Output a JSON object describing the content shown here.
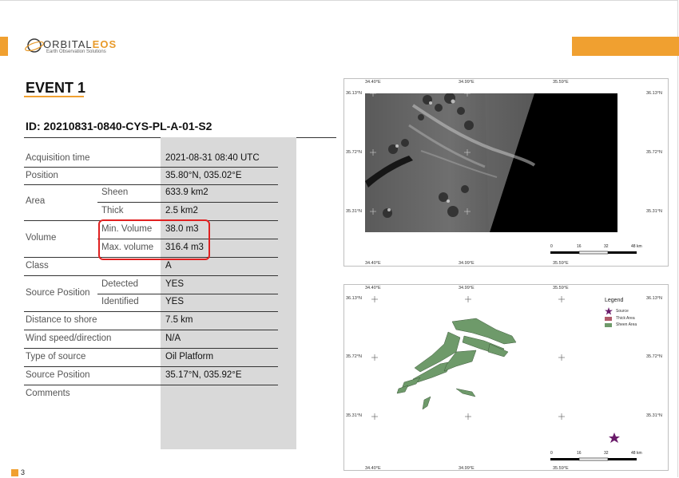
{
  "brand": {
    "name_prefix": "ORBITAL",
    "name_suffix": "EOS",
    "tagline": "Earth Observation Solutions",
    "accent_color": "#f0a030"
  },
  "event": {
    "title": "EVENT 1",
    "id": "ID: 20210831-0840-CYS-PL-A-01-S2"
  },
  "table": {
    "acquisition_time": {
      "label": "Acquisition time",
      "value": "2021-08-31 08:40 UTC"
    },
    "position": {
      "label": "Position",
      "value": "35.80°N, 035.02°E"
    },
    "area": {
      "label": "Area",
      "sheen": {
        "label": "Sheen",
        "value": "633.9 km2"
      },
      "thick": {
        "label": "Thick",
        "value": "2.5 km2"
      }
    },
    "volume": {
      "label": "Volume",
      "min": {
        "label": "Min. Volume",
        "value": "38.0 m3"
      },
      "max": {
        "label": "Max. volume",
        "value": "316.4 m3"
      }
    },
    "class": {
      "label": "Class",
      "value": "A"
    },
    "source_position_status": {
      "label": "Source Position",
      "detected": {
        "label": "Detected",
        "value": "YES"
      },
      "identified": {
        "label": "Identified",
        "value": "YES"
      }
    },
    "distance_to_shore": {
      "label": "Distance to shore",
      "value": "7.5 km"
    },
    "wind": {
      "label": "Wind speed/direction",
      "value": "N/A"
    },
    "source_type": {
      "label": "Type of source",
      "value": "Oil Platform"
    },
    "source_position": {
      "label": "Source Position",
      "value": "35.17°N, 035.92°E"
    },
    "comments": {
      "label": "Comments",
      "value": ""
    }
  },
  "maps": {
    "lon_labels": [
      "34.40°E",
      "34.99°E",
      "35.59°E"
    ],
    "lat_labels": [
      "36.13°N",
      "35.72°N",
      "35.31°N"
    ],
    "scale_labels": [
      "0",
      "16",
      "32",
      "48 km"
    ],
    "legend": {
      "title": "Legend",
      "items": [
        {
          "label": "Source",
          "color": "#6a1b6a",
          "icon": "star-icon"
        },
        {
          "label": "Thick Area",
          "color": "#b05a6a"
        },
        {
          "label": "Sheen Area",
          "color": "#6e9a6a"
        }
      ]
    }
  },
  "page": {
    "number": "3"
  }
}
